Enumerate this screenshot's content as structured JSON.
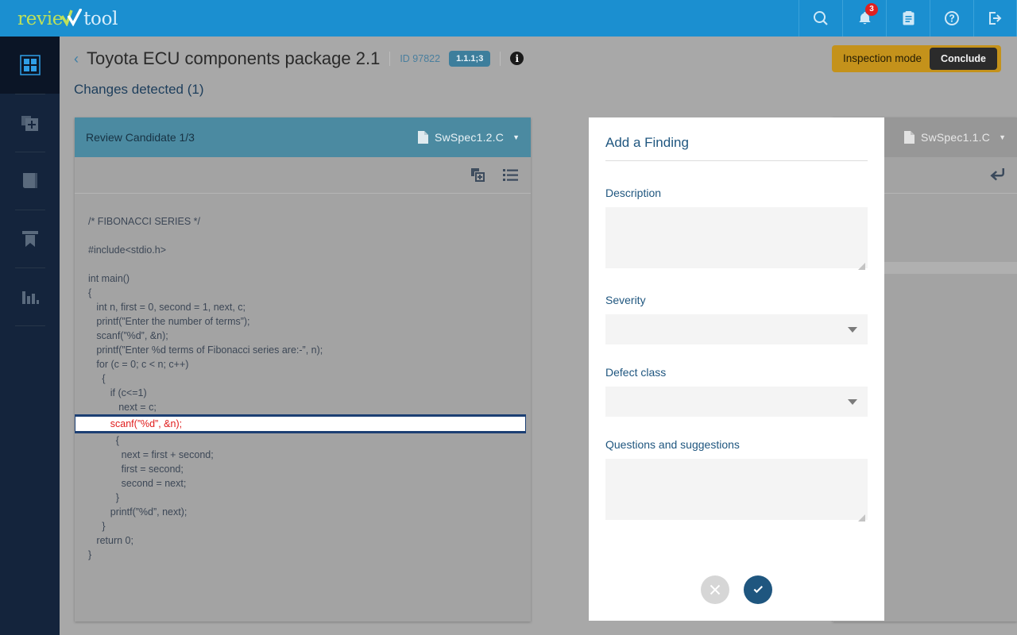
{
  "app": {
    "logo_first": "revie",
    "logo_second": "tool"
  },
  "topnav": {
    "items": [
      {
        "name": "search-icon",
        "label": "Search"
      },
      {
        "name": "notifications-icon",
        "label": "Notifications",
        "badge": "3"
      },
      {
        "name": "clipboard-icon",
        "label": "Reports"
      },
      {
        "name": "help-icon",
        "label": "Help"
      },
      {
        "name": "logout-icon",
        "label": "Log out"
      }
    ]
  },
  "sidebar": {
    "items": [
      {
        "name": "dashboard-icon",
        "label": "Dashboard",
        "active": true
      },
      {
        "name": "add-document-icon",
        "label": "New review",
        "active": false
      },
      {
        "name": "documents-icon",
        "label": "Documents",
        "active": false
      },
      {
        "name": "bookmark-icon",
        "label": "Bookmarks",
        "active": false
      },
      {
        "name": "statistics-icon",
        "label": "Statistics",
        "active": false
      }
    ]
  },
  "header": {
    "back_arrow": "‹",
    "title": "Toyota ECU components package 2.1",
    "id_label": "ID 97822",
    "version_badge": "1.1.1;3",
    "info_glyph": "i",
    "inspection_mode_label": "Inspection mode",
    "conclude_label": "Conclude"
  },
  "changes": {
    "title": "Changes detected (1)"
  },
  "left_panel": {
    "candidate_label": "Review Candidate 1/3",
    "file_name": "SwSpec1.2.C",
    "caret": "▼",
    "code_lines": [
      {
        "text": "/* FIBONACCI SERIES */",
        "highlight": false
      },
      {
        "text": "",
        "highlight": false
      },
      {
        "text": "#include<stdio.h>",
        "highlight": false
      },
      {
        "text": "",
        "highlight": false
      },
      {
        "text": "int main()",
        "highlight": false
      },
      {
        "text": "{",
        "highlight": false
      },
      {
        "text": "   int n, first = 0, second = 1, next, c;",
        "highlight": false
      },
      {
        "text": "   printf(”Enter the number of terms”);",
        "highlight": false
      },
      {
        "text": "   scanf(”%d”, &n);",
        "highlight": false
      },
      {
        "text": "   printf(”Enter %d terms of Fibonacci series are:-”, n);",
        "highlight": false
      },
      {
        "text": "   for (c = 0; c < n; c++)",
        "highlight": false
      },
      {
        "text": "     {",
        "highlight": false
      },
      {
        "text": "        if (c<=1)",
        "highlight": false
      },
      {
        "text": "           next = c;",
        "highlight": false
      },
      {
        "text": "        scanf(”%d”, &n);",
        "highlight": true
      },
      {
        "text": "          {",
        "highlight": false
      },
      {
        "text": "            next = first + second;",
        "highlight": false
      },
      {
        "text": "            first = second;",
        "highlight": false
      },
      {
        "text": "            second = next;",
        "highlight": false
      },
      {
        "text": "          }",
        "highlight": false
      },
      {
        "text": "        printf(”%d”, next);",
        "highlight": false
      },
      {
        "text": "     }",
        "highlight": false
      },
      {
        "text": "   return 0;",
        "highlight": false
      },
      {
        "text": "}",
        "highlight": false
      }
    ]
  },
  "right_panel": {
    "file_name": "SwSpec1.1.C",
    "caret": "▼"
  },
  "modal": {
    "title": "Add a Finding",
    "description_label": "Description",
    "description_value": "",
    "description_placeholder": "",
    "severity_label": "Severity",
    "severity_value": "",
    "defect_class_label": "Defect class",
    "defect_class_value": "",
    "questions_label": "Questions and suggestions",
    "questions_value": "",
    "questions_placeholder": "",
    "cancel_label": "Cancel",
    "confirm_label": "Confirm"
  },
  "colors": {
    "brand_blue": "#1b8fd0",
    "sidebar_dark": "#14243c",
    "accent_steel": "#3d7e9c",
    "warning_amber": "#c4921b",
    "panel_header_teal": "#4b8aa1",
    "highlight_red": "#e01b1b",
    "highlight_border": "#1c3f73",
    "modal_label_blue": "#1f567f",
    "badge_red": "#e02020",
    "logo_green": "#bde05a"
  }
}
